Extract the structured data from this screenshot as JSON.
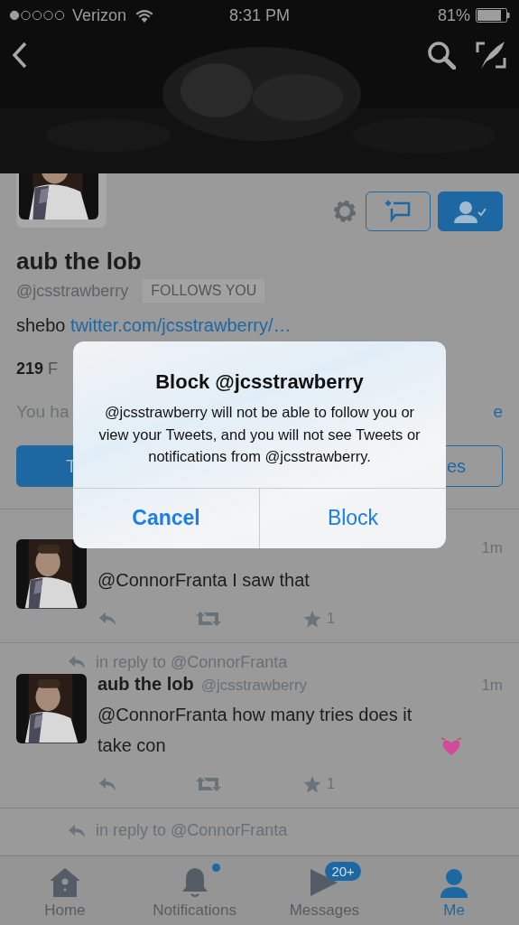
{
  "status_bar": {
    "carrier": "Verizon",
    "time": "8:31 PM",
    "battery": "81%"
  },
  "profile": {
    "name": "aub the lob",
    "handle": "@jcsstrawberry",
    "follows_badge": "FOLLOWS YOU",
    "bio_text": "shebo",
    "bio_link": "twitter.com/jcsstrawberry/…",
    "followers_count": "219",
    "followers_label": "F",
    "notice_text": "You ha",
    "notice_link": "e",
    "buttons": [
      {
        "label": "T",
        "kind": "filled"
      },
      {
        "label": "es",
        "kind": "outline"
      }
    ]
  },
  "tweets": [
    {
      "time": "1m",
      "text": "@ConnorFranta I saw that",
      "favorites": "1"
    },
    {
      "reply_to": "in reply to @ConnorFranta",
      "name": "aub the lob",
      "handle": "@jcsstrawberry",
      "time": "1m",
      "text": "@ConnorFranta how many tries does it take con",
      "favorites": "1"
    },
    {
      "reply_to": "in reply to @ConnorFranta"
    }
  ],
  "tab_bar": [
    {
      "label": "Home",
      "selected": false
    },
    {
      "label": "Notifications",
      "selected": false,
      "unread_dot": true
    },
    {
      "label": "Messages",
      "selected": false,
      "badge": "20+"
    },
    {
      "label": "Me",
      "selected": true
    }
  ],
  "dialog": {
    "title": "Block @jcsstrawberry",
    "message": "@jcsstrawberry will not be able to follow you or view your Tweets, and you will not see Tweets or notifications from @jcsstrawberry.",
    "buttons": [
      {
        "label": "Cancel",
        "kind": "cancel"
      },
      {
        "label": "Block",
        "kind": "default"
      }
    ]
  }
}
